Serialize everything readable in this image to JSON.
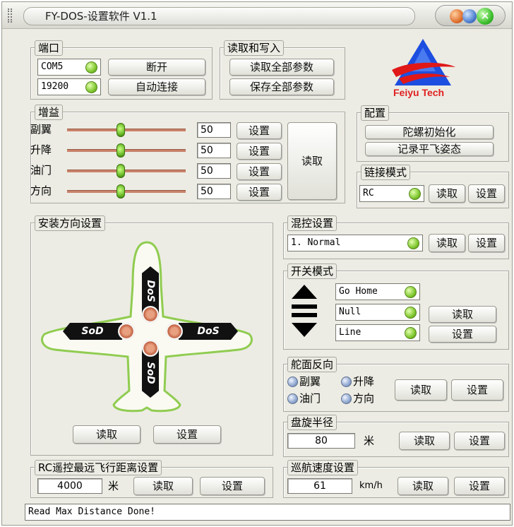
{
  "title": "FY-DOS-设置软件 V1.1",
  "port": {
    "label": "端口",
    "port_value": "COM5",
    "baud_value": "19200",
    "disconnect_label": "断开",
    "autoconnect_label": "自动连接"
  },
  "readwrite": {
    "label": "读取和写入",
    "read_all_label": "读取全部参数",
    "save_all_label": "保存全部参数"
  },
  "logo": {
    "text": "Feiyu Tech",
    "colors": {
      "blue": "#2050e0",
      "red": "#e02020"
    }
  },
  "gain": {
    "label": "增益",
    "read_label": "读取",
    "set_label": "设置",
    "rows": [
      {
        "name": "副翼",
        "value": "50",
        "level": 0.5
      },
      {
        "name": "升降",
        "value": "50",
        "level": 0.5
      },
      {
        "name": "油门",
        "value": "50",
        "level": 0.5
      },
      {
        "name": "方向",
        "value": "50",
        "level": 0.5
      }
    ]
  },
  "config": {
    "label": "配置",
    "gyro_init_label": "陀螺初始化",
    "record_level_label": "记录平飞姿态"
  },
  "link": {
    "label": "链接模式",
    "value": "RC",
    "read_label": "读取",
    "set_label": "设置"
  },
  "install": {
    "label": "安装方向设置",
    "read_label": "读取",
    "set_label": "设置",
    "arrow_text": "DoS",
    "arrow_text_rev": "SoD"
  },
  "mix": {
    "label": "混控设置",
    "value": "1. Normal",
    "read_label": "读取",
    "set_label": "设置"
  },
  "switch": {
    "label": "开关模式",
    "options": [
      "Go Home",
      "Null",
      "Line"
    ],
    "read_label": "读取",
    "set_label": "设置"
  },
  "reverse": {
    "label": "舵面反向",
    "items": [
      "副翼",
      "升降",
      "油门",
      "方向"
    ],
    "read_label": "读取",
    "set_label": "设置"
  },
  "circle": {
    "label": "盘旋半径",
    "value": "80",
    "unit": "米",
    "read_label": "读取",
    "set_label": "设置"
  },
  "rcdist": {
    "label": "RC遥控最远飞行距离设置",
    "value": "4000",
    "unit": "米",
    "read_label": "读取",
    "set_label": "设置"
  },
  "cruise": {
    "label": "巡航速度设置",
    "value": "61",
    "unit": "km/h",
    "read_label": "读取",
    "set_label": "设置"
  },
  "status": "Read Max Distance Done!"
}
